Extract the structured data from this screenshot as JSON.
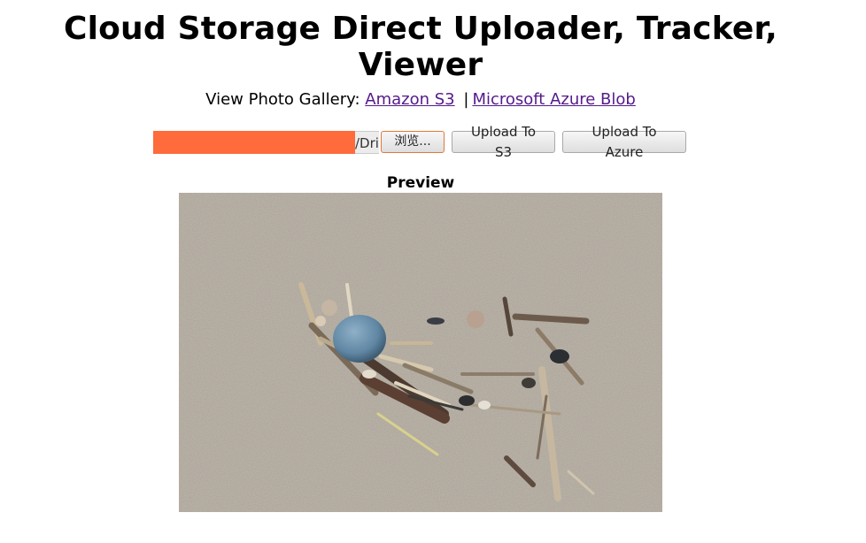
{
  "page": {
    "title": "Cloud Storage Direct Uploader, Tracker, Viewer"
  },
  "gallery": {
    "label": "View Photo Gallery:",
    "links": [
      {
        "label": "Amazon S3"
      },
      {
        "label": "Microsoft Azure Blob"
      }
    ],
    "separator": "|"
  },
  "upload": {
    "file_path_visible": "/Dri",
    "browse_label": "浏览...",
    "upload_s3_label": "Upload To S3",
    "upload_azure_label": "Upload To Azure",
    "redaction_color": "#ff6b3a"
  },
  "preview": {
    "heading": "Preview",
    "image_subject": "driftwood-and-pebbles-on-sand-photo"
  }
}
